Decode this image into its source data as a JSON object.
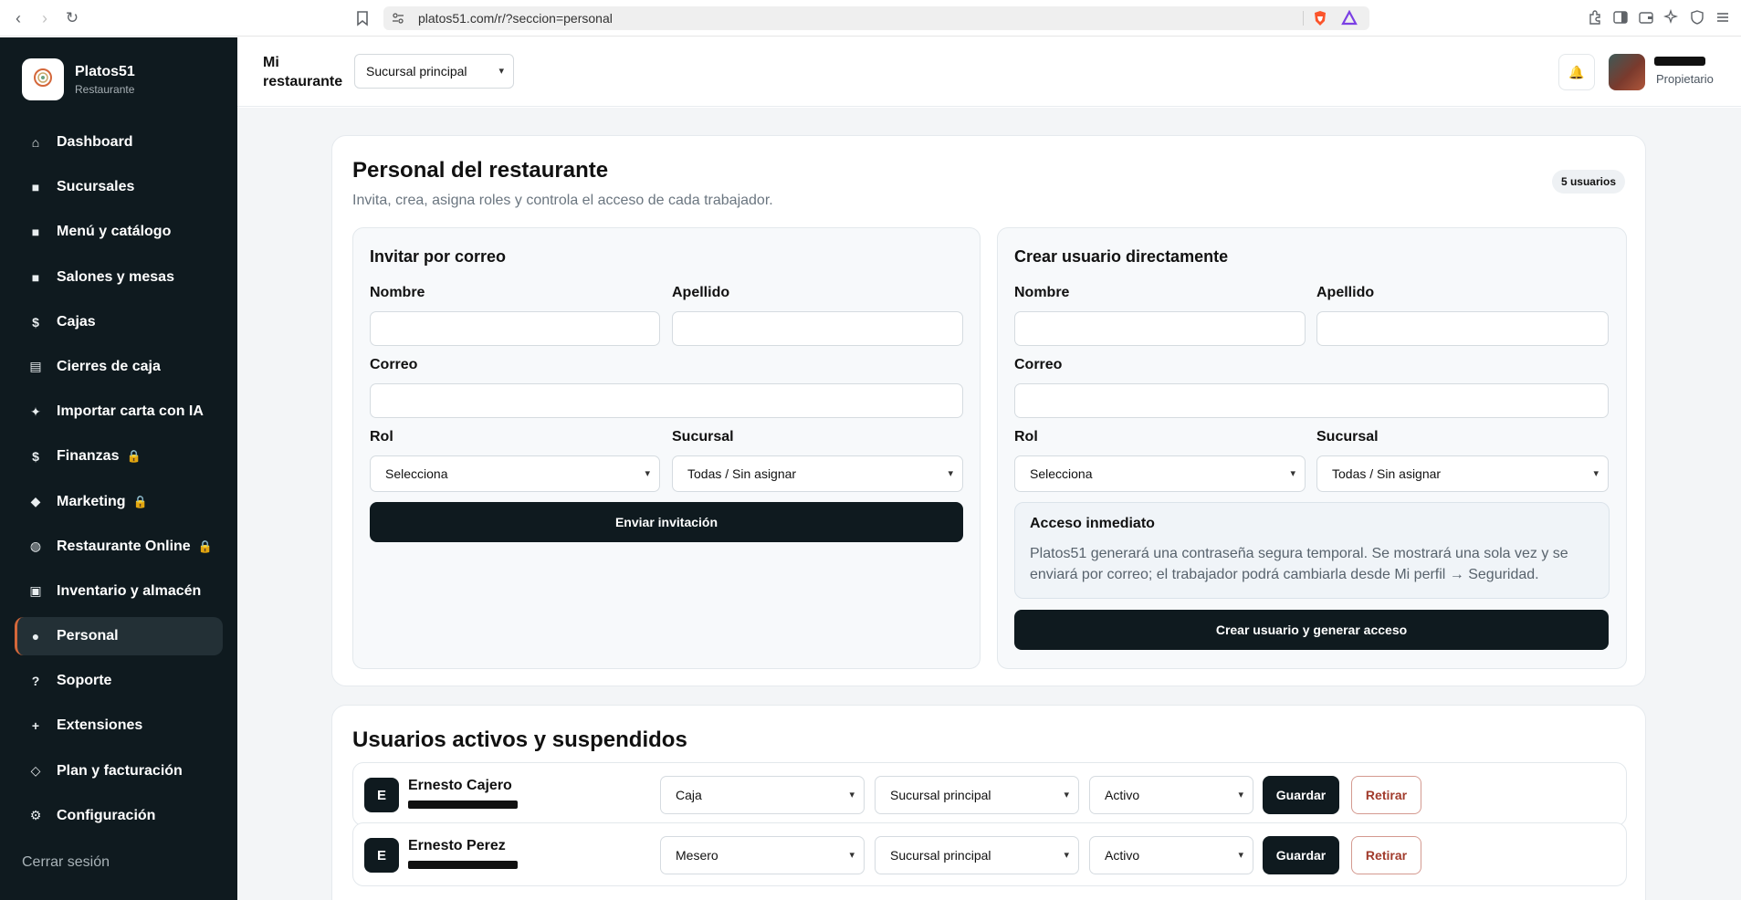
{
  "browser": {
    "url": "platos51.com/r/?seccion=personal"
  },
  "brand": {
    "name": "Platos51",
    "subtitle": "Restaurante",
    "logo_text": "PLATOS 51"
  },
  "sidebar": {
    "items": [
      {
        "label": "Dashboard",
        "icon": "home-icon",
        "glyph": "⌂",
        "locked": false,
        "active": false
      },
      {
        "label": "Sucursales",
        "icon": "branch-icon",
        "glyph": "■",
        "locked": false,
        "active": false
      },
      {
        "label": "Menú y catálogo",
        "icon": "menu-icon",
        "glyph": "■",
        "locked": false,
        "active": false
      },
      {
        "label": "Salones y mesas",
        "icon": "tables-icon",
        "glyph": "■",
        "locked": false,
        "active": false
      },
      {
        "label": "Cajas",
        "icon": "dollar-icon",
        "glyph": "$",
        "locked": false,
        "active": false
      },
      {
        "label": "Cierres de caja",
        "icon": "register-icon",
        "glyph": "▤",
        "locked": false,
        "active": false
      },
      {
        "label": "Importar carta con IA",
        "icon": "sparkle-icon",
        "glyph": "✦",
        "locked": false,
        "active": false
      },
      {
        "label": "Finanzas",
        "icon": "dollar-icon",
        "glyph": "$",
        "locked": true,
        "active": false
      },
      {
        "label": "Marketing",
        "icon": "diamond-icon",
        "glyph": "◆",
        "locked": true,
        "active": false
      },
      {
        "label": "Restaurante Online",
        "icon": "globe-icon",
        "glyph": "◍",
        "locked": true,
        "active": false
      },
      {
        "label": "Inventario y almacén",
        "icon": "inventory-icon",
        "glyph": "▣",
        "locked": false,
        "active": false
      },
      {
        "label": "Personal",
        "icon": "user-icon",
        "glyph": "●",
        "locked": false,
        "active": true
      },
      {
        "label": "Soporte",
        "icon": "help-icon",
        "glyph": "?",
        "locked": false,
        "active": false
      },
      {
        "label": "Extensiones",
        "icon": "plus-icon",
        "glyph": "+",
        "locked": false,
        "active": false
      },
      {
        "label": "Plan y facturación",
        "icon": "diamond-outline-icon",
        "glyph": "◇",
        "locked": false,
        "active": false
      },
      {
        "label": "Configuración",
        "icon": "gear-icon",
        "glyph": "⚙",
        "locked": false,
        "active": false
      }
    ],
    "logout": "Cerrar sesión",
    "lock_glyph": "🔒"
  },
  "header": {
    "title": "Mi restaurante",
    "branch": "Sucursal principal",
    "bell_glyph": "🔔",
    "role": "Propietario"
  },
  "staff": {
    "title": "Personal del restaurante",
    "subtitle": "Invita, crea, asigna roles y controla el acceso de cada trabajador.",
    "count": "5 usuarios",
    "invite": {
      "title": "Invitar por correo",
      "first_name_label": "Nombre",
      "last_name_label": "Apellido",
      "email_label": "Correo",
      "role_label": "Rol",
      "role_value": "Selecciona",
      "branch_label": "Sucursal",
      "branch_value": "Todas / Sin asignar",
      "submit": "Enviar invitación"
    },
    "create": {
      "title": "Crear usuario directamente",
      "first_name_label": "Nombre",
      "last_name_label": "Apellido",
      "email_label": "Correo",
      "role_label": "Rol",
      "role_value": "Selecciona",
      "branch_label": "Sucursal",
      "branch_value": "Todas / Sin asignar",
      "info_title": "Acceso inmediato",
      "info_text": "Platos51 generará una contraseña segura temporal. Se mostrará una sola vez y se enviará por correo; el trabajador podrá cambiarla desde Mi perfil → Seguridad.",
      "submit": "Crear usuario y generar acceso"
    }
  },
  "users": {
    "title": "Usuarios activos y suspendidos",
    "rows": [
      {
        "initial": "E",
        "name": "Ernesto Cajero",
        "role": "Caja",
        "branch": "Sucursal principal",
        "status": "Activo",
        "save": "Guardar",
        "remove": "Retirar"
      },
      {
        "initial": "E",
        "name": "Ernesto Perez",
        "role": "Mesero",
        "branch": "Sucursal principal",
        "status": "Activo",
        "save": "Guardar",
        "remove": "Retirar"
      }
    ]
  },
  "colors": {
    "sidebar_bg": "#0f1a1f",
    "accent": "#d4673a",
    "primary_button": "#0f1a1f",
    "danger_text": "#a13b2c"
  }
}
